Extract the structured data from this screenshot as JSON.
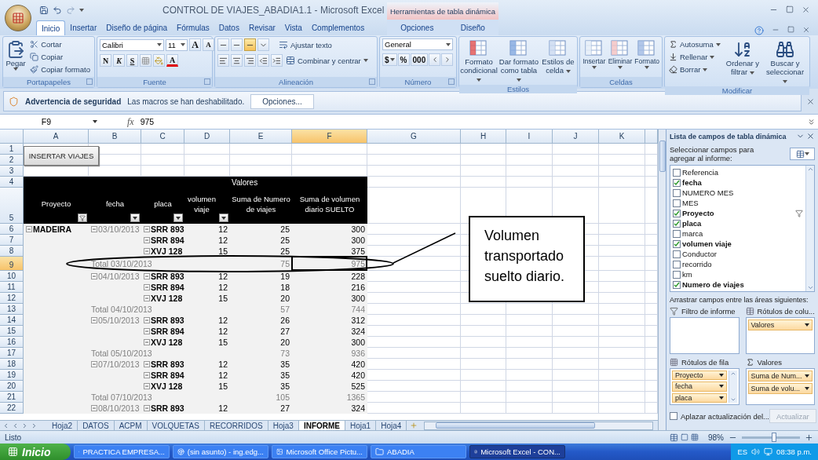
{
  "window": {
    "title": "CONTROL DE VIAJES_ABADIA1.1 - Microsoft Excel",
    "context_group": "Herramientas de tabla dinámica"
  },
  "tabs": [
    {
      "label": "Inicio",
      "selected": true,
      "kind": "main"
    },
    {
      "label": "Insertar",
      "selected": false,
      "kind": "main"
    },
    {
      "label": "Diseño de página",
      "selected": false,
      "kind": "main"
    },
    {
      "label": "Fórmulas",
      "selected": false,
      "kind": "main"
    },
    {
      "label": "Datos",
      "selected": false,
      "kind": "main"
    },
    {
      "label": "Revisar",
      "selected": false,
      "kind": "main"
    },
    {
      "label": "Vista",
      "selected": false,
      "kind": "main"
    },
    {
      "label": "Complementos",
      "selected": false,
      "kind": "main"
    },
    {
      "label": "Opciones",
      "selected": false,
      "kind": "context"
    },
    {
      "label": "Diseño",
      "selected": false,
      "kind": "context"
    }
  ],
  "ribbon": {
    "clipboard": {
      "label": "Portapapeles",
      "paste": "Pegar",
      "items": [
        "Cortar",
        "Copiar",
        "Copiar formato"
      ]
    },
    "font": {
      "label": "Fuente",
      "font": "Calibri",
      "size": "11",
      "size_buttons": [
        "A",
        "A"
      ],
      "style_buttons": [
        "N",
        "K",
        "S"
      ],
      "color_button": "A"
    },
    "alignment": {
      "label": "Alineación",
      "vertical_buttons": [
        {
          "selected": false
        },
        {
          "selected": false
        },
        {
          "selected": true
        }
      ],
      "wrap": "Ajustar texto",
      "merge": "Combinar y centrar"
    },
    "number": {
      "label": "Número",
      "format": "General",
      "buttons": [
        "$",
        "%",
        "000"
      ]
    },
    "styles": {
      "label": "Estilos",
      "buttons": [
        "Formato condicional",
        "Dar formato como tabla",
        "Estilos de celda"
      ]
    },
    "cells": {
      "label": "Celdas",
      "buttons": [
        "Insertar",
        "Eliminar",
        "Formato"
      ]
    },
    "editing": {
      "label": "Modificar",
      "small": [
        "Autosuma",
        "Rellenar",
        "Borrar"
      ],
      "large": [
        "Ordenar y filtrar",
        "Buscar y seleccionar"
      ]
    }
  },
  "security_bar": {
    "title": "Advertencia de seguridad",
    "message": "Las macros se han deshabilitado.",
    "button": "Opciones..."
  },
  "formula_bar": {
    "name_box": "F9",
    "function_label": "fx",
    "value": "975"
  },
  "sheet": {
    "columns": [
      {
        "label": "A",
        "selected": false
      },
      {
        "label": "B",
        "selected": false
      },
      {
        "label": "C",
        "selected": false
      },
      {
        "label": "D",
        "selected": false
      },
      {
        "label": "E",
        "selected": false
      },
      {
        "label": "F",
        "selected": true
      },
      {
        "label": "G",
        "selected": false
      },
      {
        "label": "H",
        "selected": false
      },
      {
        "label": "I",
        "selected": false
      },
      {
        "label": "J",
        "selected": false
      },
      {
        "label": "K",
        "selected": false
      }
    ],
    "rows": [
      {
        "label": "1",
        "selected": false
      },
      {
        "label": "2",
        "selected": false
      },
      {
        "label": "3",
        "selected": false
      },
      {
        "label": "4",
        "selected": false
      },
      {
        "label": "5",
        "selected": false
      },
      {
        "label": "6",
        "selected": false
      },
      {
        "label": "7",
        "selected": false
      },
      {
        "label": "8",
        "selected": false
      },
      {
        "label": "9",
        "selected": true
      },
      {
        "label": "10",
        "selected": false
      },
      {
        "label": "11",
        "selected": false
      },
      {
        "label": "12",
        "selected": false
      },
      {
        "label": "13",
        "selected": false
      },
      {
        "label": "14",
        "selected": false
      },
      {
        "label": "15",
        "selected": false
      },
      {
        "label": "16",
        "selected": false
      },
      {
        "label": "17",
        "selected": false
      },
      {
        "label": "18",
        "selected": false
      },
      {
        "label": "19",
        "selected": false
      },
      {
        "label": "20",
        "selected": false
      },
      {
        "label": "21",
        "selected": false
      },
      {
        "label": "22",
        "selected": false
      }
    ],
    "button": "INSERTAR VIAJES",
    "callout": "Volumen transportado suelto diario.",
    "pivot": {
      "values_caption": "Valores",
      "headers": [
        {
          "label": "Proyecto",
          "kind": "filter"
        },
        {
          "label": "fecha",
          "kind": "dropdown"
        },
        {
          "label": "placa",
          "kind": "dropdown"
        },
        {
          "label": "volumen viaje",
          "kind": "dropdown"
        },
        {
          "label": "Suma de Numero de viajes",
          "kind": "plain"
        },
        {
          "label": "Suma de volumen diario SUELTO",
          "kind": "plain"
        }
      ],
      "rows": [
        {
          "kind": "item",
          "proyecto": "MADEIRA",
          "fecha": "03/10/2013",
          "placa": "SRR 893",
          "volumen": "12",
          "viajes": "25",
          "suelto": "300"
        },
        {
          "kind": "item",
          "placa": "SRR 894",
          "volumen": "12",
          "viajes": "25",
          "suelto": "300"
        },
        {
          "kind": "item",
          "placa": "XVJ 128",
          "volumen": "15",
          "viajes": "25",
          "suelto": "375"
        },
        {
          "kind": "total",
          "label": "Total 03/10/2013",
          "viajes": "75",
          "suelto": "975"
        },
        {
          "kind": "item",
          "fecha": "04/10/2013",
          "placa": "SRR 893",
          "volumen": "12",
          "viajes": "19",
          "suelto": "228"
        },
        {
          "kind": "item",
          "placa": "SRR 894",
          "volumen": "12",
          "viajes": "18",
          "suelto": "216"
        },
        {
          "kind": "item",
          "placa": "XVJ 128",
          "volumen": "15",
          "viajes": "20",
          "suelto": "300"
        },
        {
          "kind": "total",
          "label": "Total 04/10/2013",
          "viajes": "57",
          "suelto": "744"
        },
        {
          "kind": "item",
          "fecha": "05/10/2013",
          "placa": "SRR 893",
          "volumen": "12",
          "viajes": "26",
          "suelto": "312"
        },
        {
          "kind": "item",
          "placa": "SRR 894",
          "volumen": "12",
          "viajes": "27",
          "suelto": "324"
        },
        {
          "kind": "item",
          "placa": "XVJ 128",
          "volumen": "15",
          "viajes": "20",
          "suelto": "300"
        },
        {
          "kind": "total",
          "label": "Total 05/10/2013",
          "viajes": "73",
          "suelto": "936"
        },
        {
          "kind": "item",
          "fecha": "07/10/2013",
          "placa": "SRR 893",
          "volumen": "12",
          "viajes": "35",
          "suelto": "420"
        },
        {
          "kind": "item",
          "placa": "SRR 894",
          "volumen": "12",
          "viajes": "35",
          "suelto": "420"
        },
        {
          "kind": "item",
          "placa": "XVJ 128",
          "volumen": "15",
          "viajes": "35",
          "suelto": "525"
        },
        {
          "kind": "total",
          "label": "Total 07/10/2013",
          "viajes": "105",
          "suelto": "1365"
        },
        {
          "kind": "item",
          "fecha": "08/10/2013",
          "placa": "SRR 893",
          "volumen": "12",
          "viajes": "27",
          "suelto": "324"
        }
      ]
    }
  },
  "sheet_tabs": [
    {
      "label": "Hoja2",
      "selected": false
    },
    {
      "label": "DATOS",
      "selected": false
    },
    {
      "label": "ACPM",
      "selected": false
    },
    {
      "label": "VOLQUETAS",
      "selected": false
    },
    {
      "label": "RECORRIDOS",
      "selected": false
    },
    {
      "label": "Hoja3",
      "selected": false
    },
    {
      "label": "INFORME",
      "selected": true
    },
    {
      "label": "Hoja1",
      "selected": false
    },
    {
      "label": "Hoja4",
      "selected": false
    }
  ],
  "pivot_field_list": {
    "title": "Lista de campos de tabla dinámica",
    "instruction": "Seleccionar campos para agregar al informe:",
    "fields": [
      {
        "label": "Referencia",
        "checked": false,
        "filtered": false
      },
      {
        "label": "fecha",
        "checked": true,
        "filtered": false
      },
      {
        "label": "NUMERO MES",
        "checked": false,
        "filtered": false
      },
      {
        "label": "MES",
        "checked": false,
        "filtered": false
      },
      {
        "label": "Proyecto",
        "checked": true,
        "filtered": true
      },
      {
        "label": "placa",
        "checked": true,
        "filtered": false
      },
      {
        "label": "marca",
        "checked": false,
        "filtered": false
      },
      {
        "label": "volumen viaje",
        "checked": true,
        "filtered": false
      },
      {
        "label": "Conductor",
        "checked": false,
        "filtered": false
      },
      {
        "label": "recorrido",
        "checked": false,
        "filtered": false
      },
      {
        "label": "km",
        "checked": false,
        "filtered": false
      },
      {
        "label": "Numero de viajes",
        "checked": true,
        "filtered": false
      }
    ],
    "areas_caption": "Arrastrar campos entre las áreas siguientes:",
    "areas": [
      {
        "kind": "filter",
        "label": "Filtro de informe"
      },
      {
        "kind": "columns",
        "label": "Rótulos de colu...",
        "items": [
          "Valores"
        ]
      },
      {
        "kind": "rows",
        "label": "Rótulos de fila",
        "items": [
          "Proyecto",
          "fecha",
          "placa"
        ]
      },
      {
        "kind": "values",
        "label": "Valores",
        "items": [
          "Suma de Num...",
          "Suma de volu..."
        ]
      }
    ],
    "defer": {
      "label": "Aplazar actualización del...",
      "checked": false
    },
    "update_button": {
      "label": "Actualizar",
      "disabled": true
    }
  },
  "status_bar": {
    "status": "Listo",
    "zoom": "98%",
    "zoom_slider": {
      "level": 0.55
    }
  },
  "taskbar": {
    "start": "Inicio",
    "items": [
      {
        "label": "PRACTICA EMPRESA...",
        "selected": false
      },
      {
        "label": "(sin asunto) - ing.edg...",
        "selected": false
      },
      {
        "label": "Microsoft Office Pictu...",
        "selected": false
      },
      {
        "label": "ABADIA",
        "selected": false
      },
      {
        "label": "Microsoft Excel - CON...",
        "selected": true
      }
    ],
    "language": "ES",
    "time": "08:38 p.m."
  }
}
